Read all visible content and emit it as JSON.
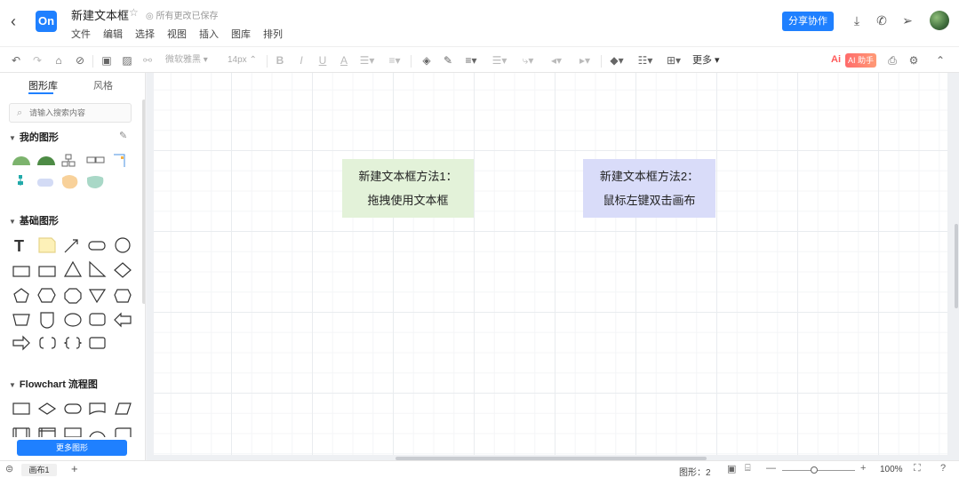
{
  "header": {
    "back_icon": "chevron-left-icon",
    "logo_text": "On",
    "doc_title": "新建文本框",
    "save_status": "所有更改已保存",
    "menu": [
      "文件",
      "编辑",
      "选择",
      "视图",
      "插入",
      "图库",
      "排列"
    ],
    "share_label": "分享协作",
    "icons": [
      "download-icon",
      "phone-icon",
      "send-icon"
    ]
  },
  "toolbar": {
    "font_family": "微软雅黑",
    "font_size": "14px",
    "more_label": "更多",
    "ai_logo": "Ai",
    "ai_badge": "AI 助手"
  },
  "sidebar": {
    "tabs": [
      "图形库",
      "风格"
    ],
    "search_placeholder": "请输入搜索内容",
    "sections": {
      "my_shapes": "我的图形",
      "basic_shapes": "基础图形",
      "flowchart": "Flowchart 流程图"
    },
    "more_shapes_label": "更多图形"
  },
  "canvas": {
    "textbox1": {
      "line1": "新建文本框方法1：",
      "line2": "拖拽使用文本框",
      "color": "#e3f2d9"
    },
    "textbox2": {
      "line1": "新建文本框方法2：",
      "line2": "鼠标左键双击画布",
      "color": "#d9dcf9"
    }
  },
  "footer": {
    "page_tab": "画布1",
    "shape_count": "图形：2",
    "zoom": "100%"
  },
  "colors": {
    "accent": "#1f80ff"
  }
}
